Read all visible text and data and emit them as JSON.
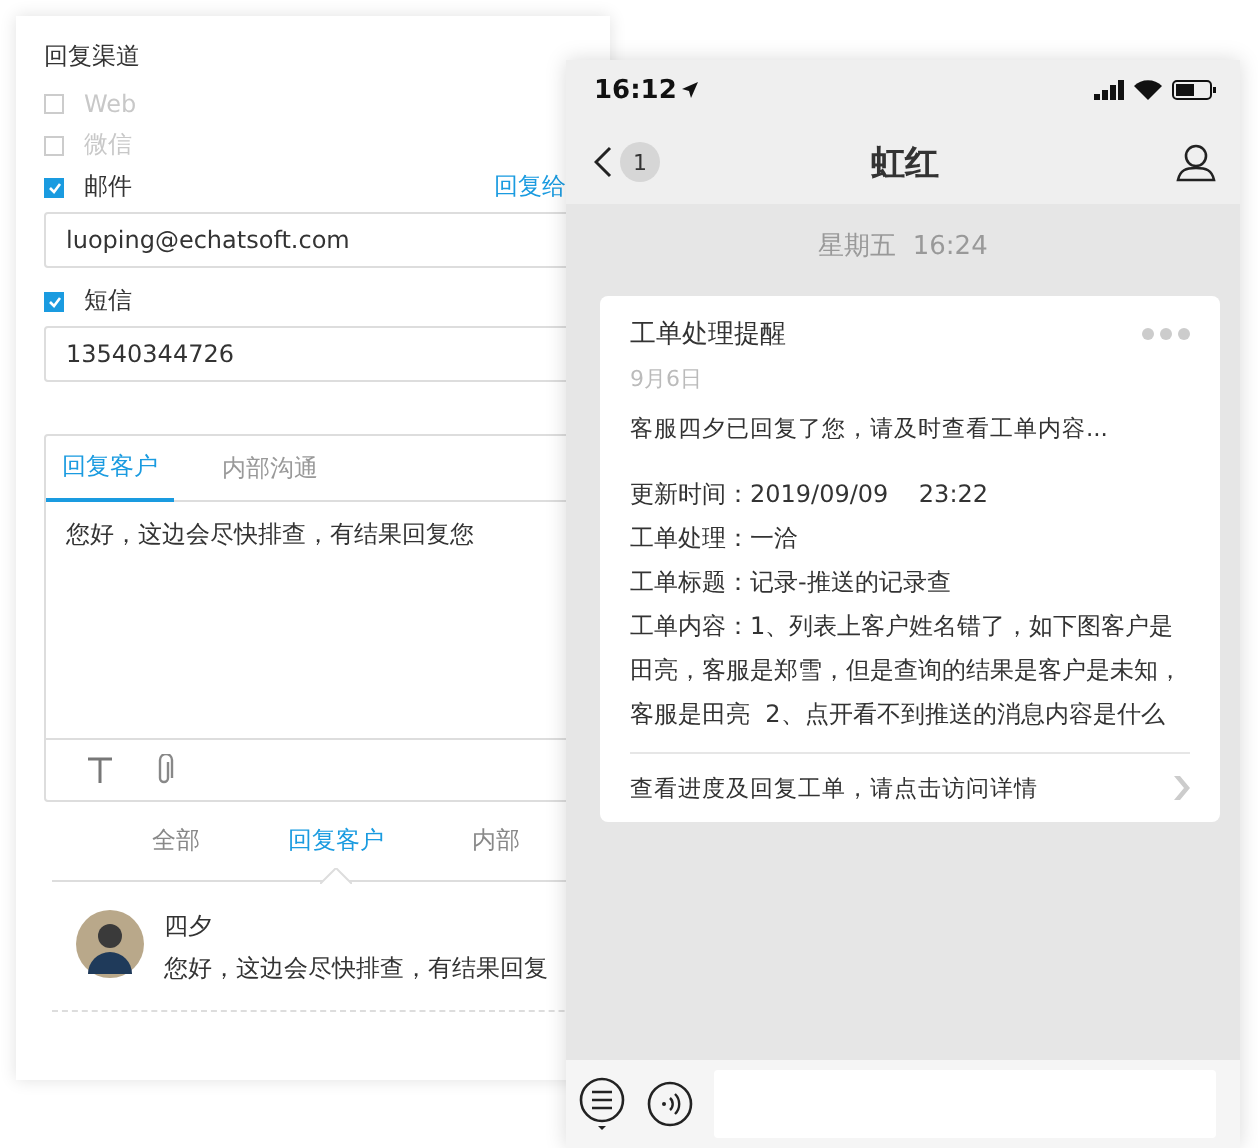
{
  "reply_panel": {
    "title": "回复渠道",
    "channels": [
      {
        "kind": "plain",
        "label": "Web",
        "checked": false,
        "disabled": true
      },
      {
        "kind": "plain",
        "label": "微信",
        "checked": false,
        "disabled": true
      },
      {
        "kind": "field",
        "label": "邮件",
        "checked": true,
        "disabled": false,
        "link": "回复给",
        "value": "luoping@echatsoft.com"
      },
      {
        "kind": "field",
        "label": "短信",
        "checked": true,
        "disabled": false,
        "value": "13540344726"
      }
    ],
    "editor_tabs": [
      {
        "label": "回复客户",
        "selected": true
      },
      {
        "label": "内部沟通",
        "selected": false
      }
    ],
    "editor_text": "您好，这边会尽快排查，有结果回复您",
    "filter_tabs": [
      {
        "label": "全部",
        "selected": false
      },
      {
        "label": "回复客户",
        "selected": true
      },
      {
        "label": "内部",
        "selected": false
      }
    ],
    "messages": [
      {
        "name": "四夕",
        "text": "您好，这边会尽快排查，有结果回复"
      }
    ]
  },
  "phone": {
    "status_time": "16:12",
    "back_count": "1",
    "title": "虹红",
    "timestamp": "星期五  16:24",
    "card": {
      "title": "工单处理提醒",
      "date": "9月6日",
      "summary": "客服四夕已回复了您，请及时查看工单内容...",
      "fields": [
        "更新时间：2019/09/09    23:22",
        "工单处理：一洽",
        "工单标题：记录-推送的记录查",
        "工单内容：1、列表上客户姓名错了，如下图客户是田亮，客服是郑雪，但是查询的结果是客户是未知，客服是田亮  2、点开看不到推送的消息内容是什么"
      ],
      "footer": "查看进度及回复工单，请点击访问详情"
    }
  }
}
